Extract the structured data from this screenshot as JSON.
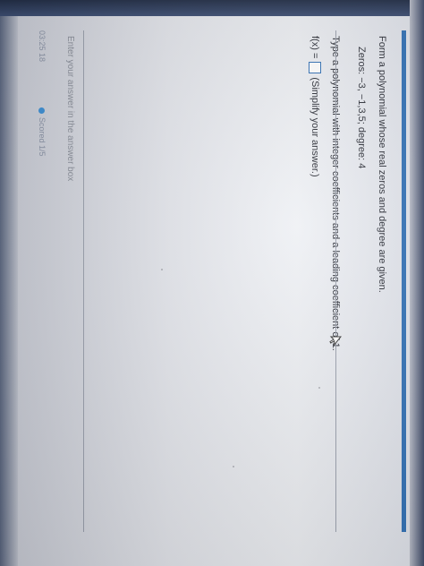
{
  "question": {
    "prompt": "Form a polynomial whose real zeros and degree are given.",
    "given": "Zeros: −3, −1,3,5;   degree: 4",
    "instruction": "Type a polynomial with integer coefficients and a leading coefficient of 1.",
    "answer_prefix": "f(x) =",
    "answer_value": "",
    "answer_note": "(Simplify your answer.)"
  },
  "hint": "Enter your answer in the answer box",
  "footer": {
    "left_text": "03:25 18",
    "score_text": "Scored 1/5"
  },
  "colors": {
    "accent": "#2f6fb5",
    "status_dot": "#3a8fd6"
  },
  "icons": {
    "cursor": "mouse-pointer-icon",
    "status": "status-dot-icon"
  }
}
